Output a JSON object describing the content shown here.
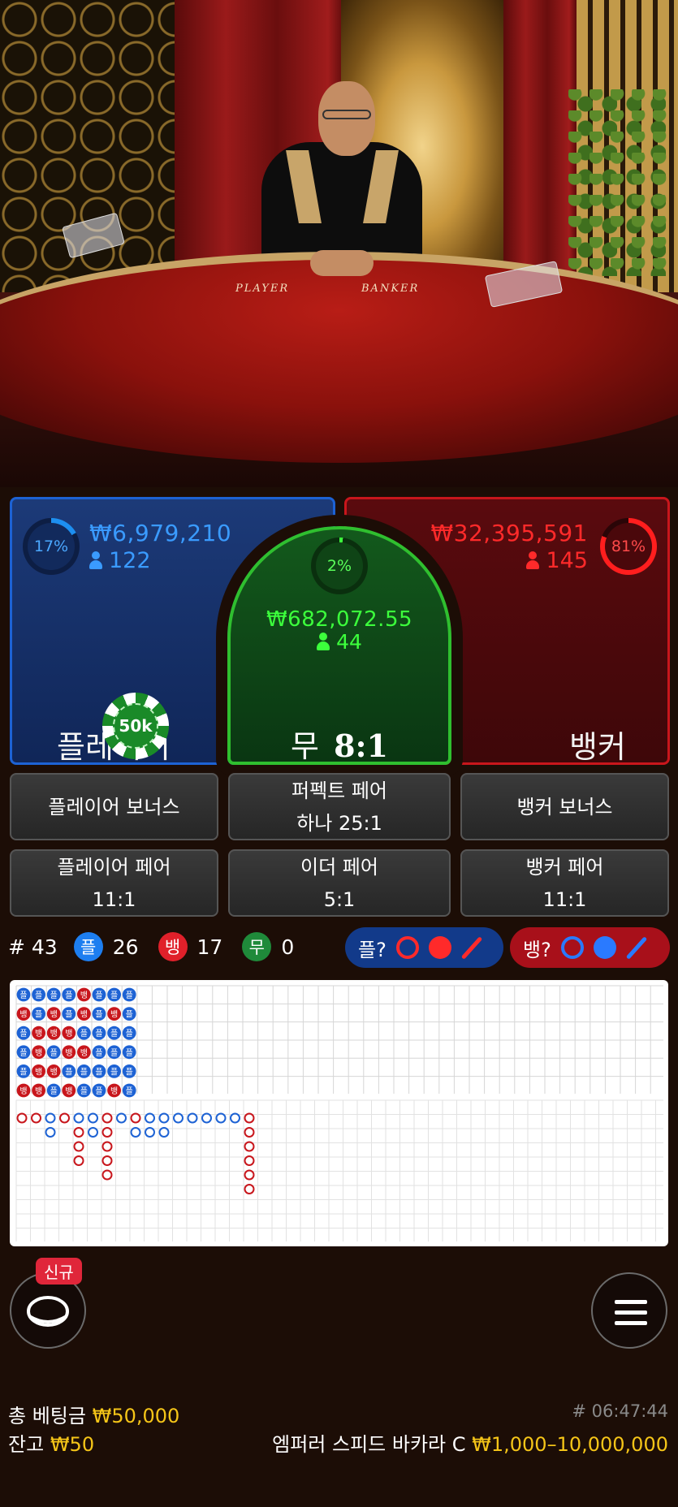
{
  "video": {
    "table_player": "PLAYER",
    "table_banker": "BANKER"
  },
  "colors": {
    "player": "#1d62d4",
    "banker": "#c8161c",
    "tie": "#2fbf2f",
    "gold": "#f5c518"
  },
  "bets": {
    "player": {
      "percent": "17%",
      "amount": "₩6,979,210",
      "count": "122",
      "label": "플레이어"
    },
    "tie": {
      "percent": "2%",
      "amount": "₩682,072.55",
      "count": "44",
      "label": "무",
      "odds": "8:1"
    },
    "banker": {
      "percent": "81%",
      "amount": "₩32,395,591",
      "count": "145",
      "label": "뱅커"
    }
  },
  "chip": {
    "value": "50k"
  },
  "side_bets": [
    {
      "line1": "플레이어 보너스",
      "line2": ""
    },
    {
      "line1": "퍼펙트 페어",
      "line2": "하나 25:1"
    },
    {
      "line1": "뱅커 보너스",
      "line2": ""
    },
    {
      "line1": "플레이어 페어",
      "line2": "11:1"
    },
    {
      "line1": "이더 페어",
      "line2": "5:1"
    },
    {
      "line1": "뱅커 페어",
      "line2": "11:1"
    }
  ],
  "stats": {
    "round": "# 43",
    "player_badge": "플",
    "player_count": "26",
    "banker_badge": "뱅",
    "banker_count": "17",
    "tie_badge": "무",
    "tie_count": "0",
    "player_predict": "플?",
    "banker_predict": "뱅?"
  },
  "bead_road": [
    [
      "P",
      "B",
      "P",
      "P",
      "P",
      "B"
    ],
    [
      "P",
      "P",
      "B",
      "B",
      "B",
      "B"
    ],
    [
      "P",
      "B",
      "B",
      "P",
      "B",
      "P"
    ],
    [
      "P",
      "P",
      "B",
      "B",
      "P",
      "B"
    ],
    [
      "B",
      "B",
      "P",
      "B",
      "P",
      "P"
    ],
    [
      "P",
      "P",
      "P",
      "P",
      "P",
      "P"
    ],
    [
      "P",
      "B",
      "P",
      "P",
      "P",
      "B"
    ],
    [
      "P",
      "P",
      "P",
      "P",
      "P",
      "P"
    ]
  ],
  "big_road": [
    [
      "B"
    ],
    [
      "B"
    ],
    [
      "P",
      "P"
    ],
    [
      "B"
    ],
    [
      "P",
      "B",
      "B",
      "B"
    ],
    [
      "P",
      "P"
    ],
    [
      "B",
      "B",
      "B",
      "B",
      "B"
    ],
    [
      "P"
    ],
    [
      "B",
      "P"
    ],
    [
      "P",
      "P"
    ],
    [
      "P",
      "P"
    ],
    [
      "P"
    ],
    [
      "P"
    ],
    [
      "P"
    ],
    [
      "P"
    ],
    [
      "P"
    ],
    [
      "B",
      "B",
      "B",
      "B",
      "B",
      "B"
    ]
  ],
  "new_badge": "신규",
  "footer": {
    "total_bet_label": "총 베팅금",
    "total_bet": "₩50,000",
    "balance_label": "잔고",
    "balance": "₩50",
    "time": "# 06:47:44",
    "table_name": "엠퍼러 스피드 바카라 C",
    "limits": "₩1,000–10,000,000"
  },
  "icons": [
    "chat-icon",
    "menu-icon",
    "person-icon"
  ]
}
